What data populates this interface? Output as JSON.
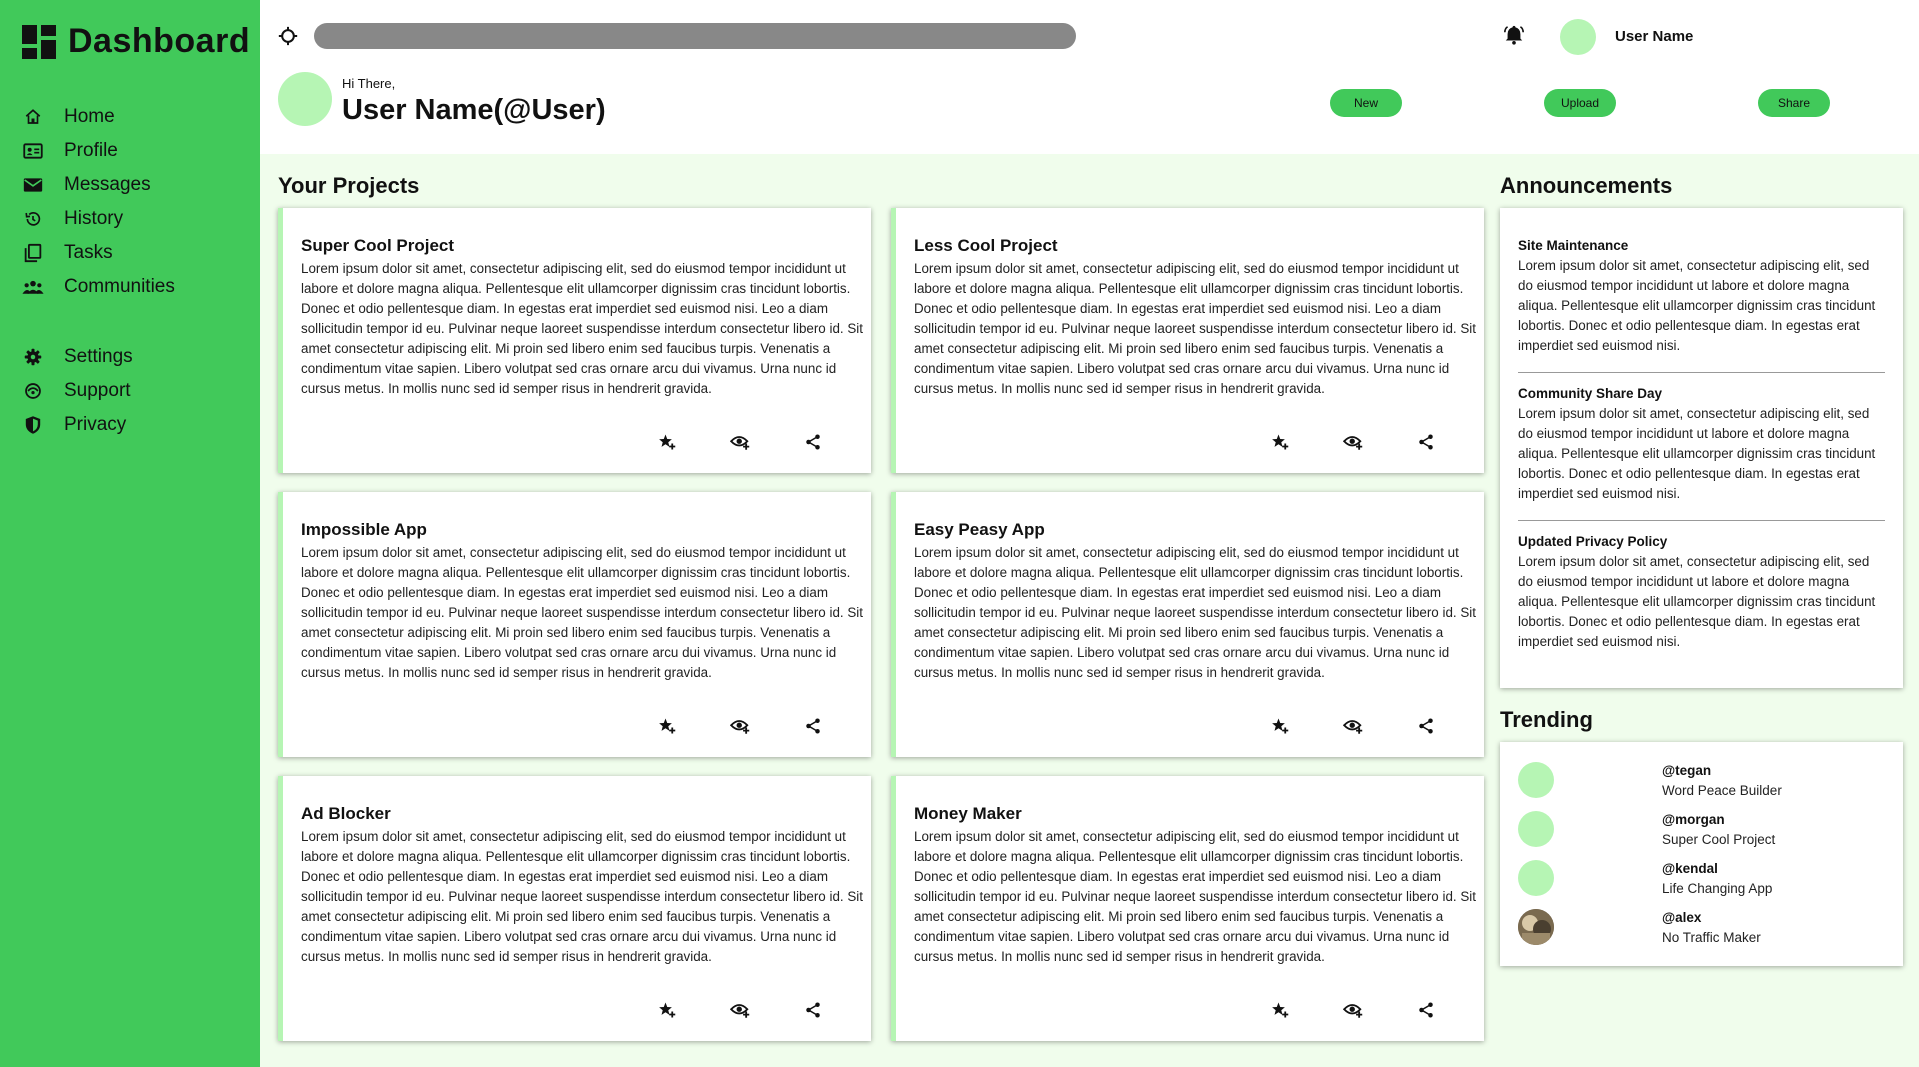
{
  "sidebar": {
    "title": "Dashboard",
    "items": [
      {
        "label": "Home",
        "icon": "home-icon"
      },
      {
        "label": "Profile",
        "icon": "id-card-icon"
      },
      {
        "label": "Messages",
        "icon": "mail-icon"
      },
      {
        "label": "History",
        "icon": "history-icon"
      },
      {
        "label": "Tasks",
        "icon": "tasks-icon"
      },
      {
        "label": "Communities",
        "icon": "people-icon"
      }
    ],
    "secondary_items": [
      {
        "label": "Settings",
        "icon": "gear-icon"
      },
      {
        "label": "Support",
        "icon": "support-icon"
      },
      {
        "label": "Privacy",
        "icon": "shield-icon"
      }
    ]
  },
  "topbar": {
    "user_name": "User Name"
  },
  "greeting": {
    "hi": "Hi There,",
    "name": "User Name(@User)",
    "buttons": [
      "New",
      "Upload",
      "Share"
    ]
  },
  "projects": {
    "title": "Your Projects",
    "items": [
      {
        "title": "Super Cool Project",
        "body": "Lorem ipsum dolor sit amet, consectetur adipiscing elit, sed do eiusmod tempor incididunt ut labore et dolore magna aliqua. Pellentesque elit ullamcorper dignissim cras tincidunt lobortis. Donec et odio pellentesque diam. In egestas erat imperdiet sed euismod nisi. Leo a diam sollicitudin tempor id eu. Pulvinar neque laoreet suspendisse interdum consectetur libero id. Sit amet consectetur adipiscing elit. Mi proin sed libero enim sed faucibus turpis. Venenatis a condimentum vitae sapien. Libero volutpat sed cras ornare arcu dui vivamus. Urna nunc id cursus metus. In mollis nunc sed id semper risus in hendrerit gravida."
      },
      {
        "title": "Less Cool Project",
        "body": "Lorem ipsum dolor sit amet, consectetur adipiscing elit, sed do eiusmod tempor incididunt ut labore et dolore magna aliqua. Pellentesque elit ullamcorper dignissim cras tincidunt lobortis. Donec et odio pellentesque diam. In egestas erat imperdiet sed euismod nisi. Leo a diam sollicitudin tempor id eu. Pulvinar neque laoreet suspendisse interdum consectetur libero id. Sit amet consectetur adipiscing elit. Mi proin sed libero enim sed faucibus turpis. Venenatis a condimentum vitae sapien. Libero volutpat sed cras ornare arcu dui vivamus. Urna nunc id cursus metus. In mollis nunc sed id semper risus in hendrerit gravida."
      },
      {
        "title": "Impossible App",
        "body": "Lorem ipsum dolor sit amet, consectetur adipiscing elit, sed do eiusmod tempor incididunt ut labore et dolore magna aliqua. Pellentesque elit ullamcorper dignissim cras tincidunt lobortis. Donec et odio pellentesque diam. In egestas erat imperdiet sed euismod nisi. Leo a diam sollicitudin tempor id eu. Pulvinar neque laoreet suspendisse interdum consectetur libero id. Sit amet consectetur adipiscing elit. Mi proin sed libero enim sed faucibus turpis. Venenatis a condimentum vitae sapien. Libero volutpat sed cras ornare arcu dui vivamus. Urna nunc id cursus metus. In mollis nunc sed id semper risus in hendrerit gravida."
      },
      {
        "title": "Easy Peasy App",
        "body": "Lorem ipsum dolor sit amet, consectetur adipiscing elit, sed do eiusmod tempor incididunt ut labore et dolore magna aliqua. Pellentesque elit ullamcorper dignissim cras tincidunt lobortis. Donec et odio pellentesque diam. In egestas erat imperdiet sed euismod nisi. Leo a diam sollicitudin tempor id eu. Pulvinar neque laoreet suspendisse interdum consectetur libero id. Sit amet consectetur adipiscing elit. Mi proin sed libero enim sed faucibus turpis. Venenatis a condimentum vitae sapien. Libero volutpat sed cras ornare arcu dui vivamus. Urna nunc id cursus metus. In mollis nunc sed id semper risus in hendrerit gravida."
      },
      {
        "title": "Ad Blocker",
        "body": "Lorem ipsum dolor sit amet, consectetur adipiscing elit, sed do eiusmod tempor incididunt ut labore et dolore magna aliqua. Pellentesque elit ullamcorper dignissim cras tincidunt lobortis. Donec et odio pellentesque diam. In egestas erat imperdiet sed euismod nisi. Leo a diam sollicitudin tempor id eu. Pulvinar neque laoreet suspendisse interdum consectetur libero id. Sit amet consectetur adipiscing elit. Mi proin sed libero enim sed faucibus turpis. Venenatis a condimentum vitae sapien. Libero volutpat sed cras ornare arcu dui vivamus. Urna nunc id cursus metus. In mollis nunc sed id semper risus in hendrerit gravida."
      },
      {
        "title": "Money Maker",
        "body": "Lorem ipsum dolor sit amet, consectetur adipiscing elit, sed do eiusmod tempor incididunt ut labore et dolore magna aliqua. Pellentesque elit ullamcorper dignissim cras tincidunt lobortis. Donec et odio pellentesque diam. In egestas erat imperdiet sed euismod nisi. Leo a diam sollicitudin tempor id eu. Pulvinar neque laoreet suspendisse interdum consectetur libero id. Sit amet consectetur adipiscing elit. Mi proin sed libero enim sed faucibus turpis. Venenatis a condimentum vitae sapien. Libero volutpat sed cras ornare arcu dui vivamus. Urna nunc id cursus metus. In mollis nunc sed id semper risus in hendrerit gravida."
      }
    ],
    "action_icons": [
      "star-add-icon",
      "watch-icon",
      "share-icon"
    ]
  },
  "announcements": {
    "title": "Announcements",
    "items": [
      {
        "title": "Site Maintenance",
        "body": "Lorem ipsum dolor sit amet, consectetur adipiscing elit, sed do eiusmod tempor incididunt ut labore et dolore magna aliqua. Pellentesque elit ullamcorper dignissim cras tincidunt lobortis. Donec et odio pellentesque diam. In egestas erat imperdiet sed euismod nisi."
      },
      {
        "title": "Community Share Day",
        "body": "Lorem ipsum dolor sit amet, consectetur adipiscing elit, sed do eiusmod tempor incididunt ut labore et dolore magna aliqua. Pellentesque elit ullamcorper dignissim cras tincidunt lobortis. Donec et odio pellentesque diam. In egestas erat imperdiet sed euismod nisi."
      },
      {
        "title": "Updated Privacy Policy",
        "body": "Lorem ipsum dolor sit amet, consectetur adipiscing elit, sed do eiusmod tempor incididunt ut labore et dolore magna aliqua. Pellentesque elit ullamcorper dignissim cras tincidunt lobortis. Donec et odio pellentesque diam. In egestas erat imperdiet sed euismod nisi."
      }
    ]
  },
  "trending": {
    "title": "Trending",
    "items": [
      {
        "handle": "@tegan",
        "project": "Word Peace Builder"
      },
      {
        "handle": "@morgan",
        "project": "Super Cool Project"
      },
      {
        "handle": "@kendal",
        "project": "Life Changing App"
      },
      {
        "handle": "@alex",
        "project": "No Traffic Maker"
      }
    ]
  },
  "colors": {
    "accent": "#41c95a",
    "accent_light": "#b6f5b4",
    "content_bg": "#f0fdec",
    "search_bar": "#888888"
  }
}
